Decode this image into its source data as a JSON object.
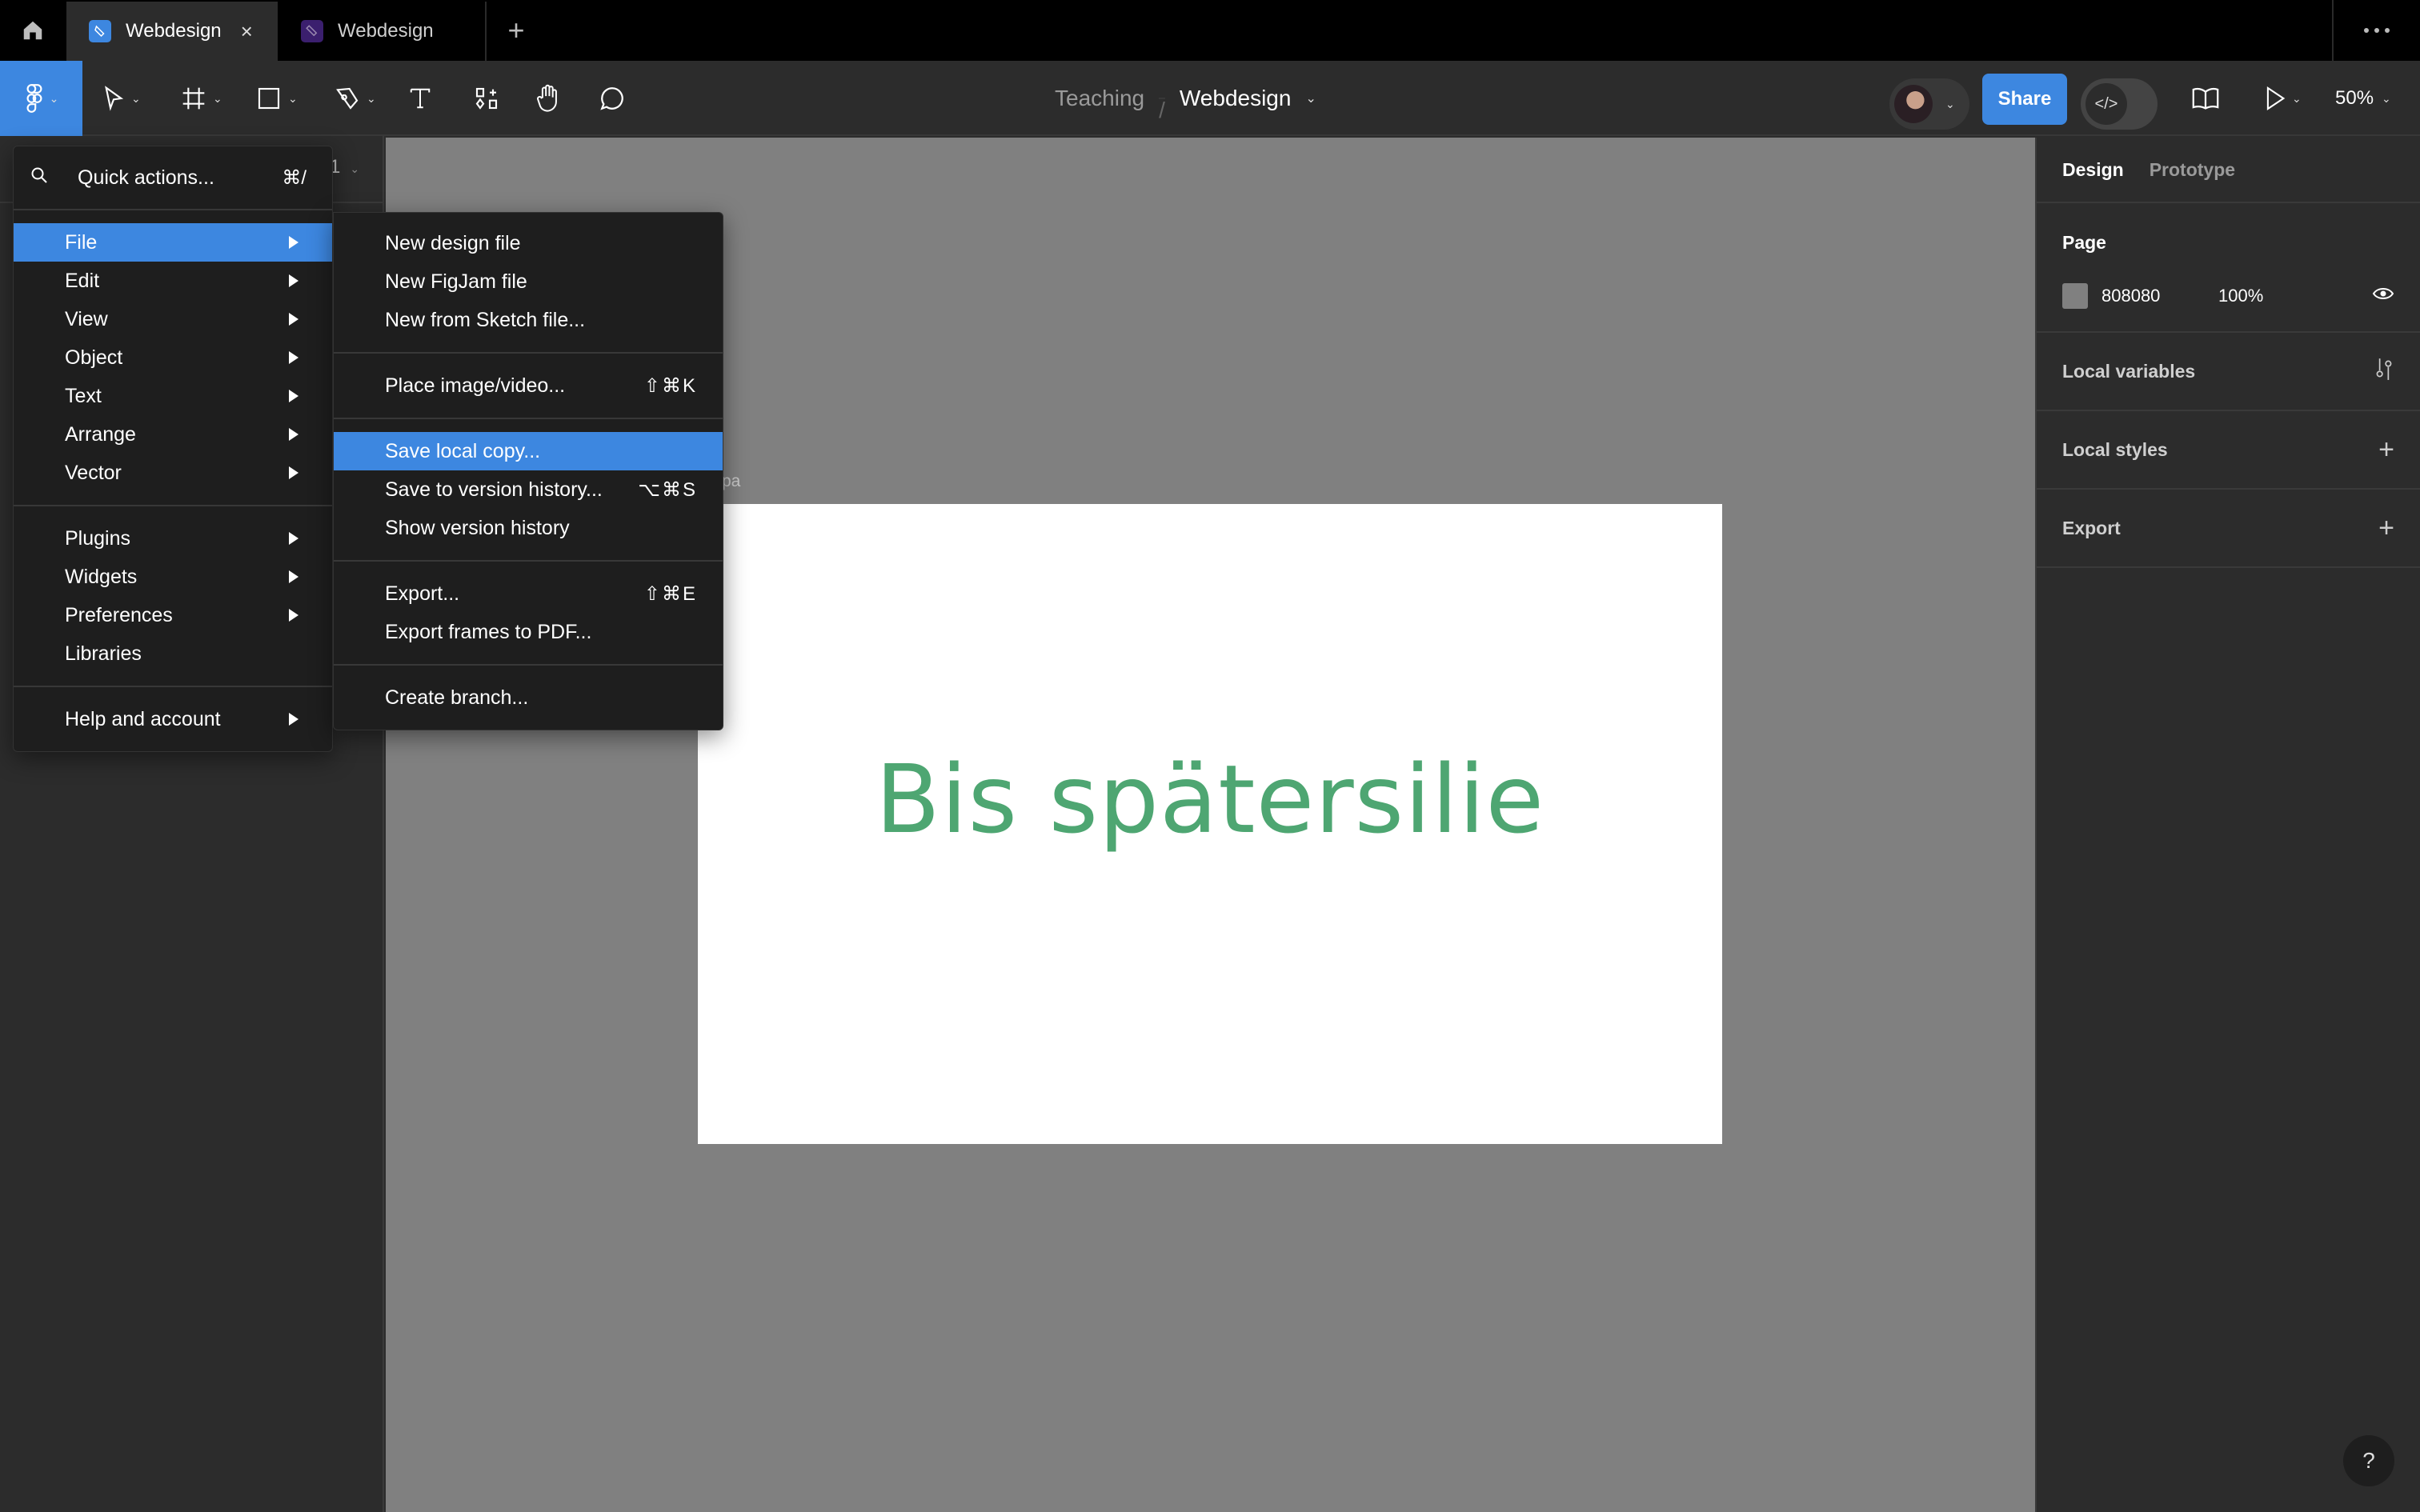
{
  "tabs": {
    "home_icon": "home-icon",
    "items": [
      {
        "label": "Webdesign",
        "icon": "figma-design-file-icon",
        "icon_color": "#3d87e0",
        "active": true,
        "close": "×"
      },
      {
        "label": "Webdesign",
        "icon": "figjam-file-icon",
        "icon_color": "#3b1f6e",
        "active": false
      }
    ],
    "new_tab": "+"
  },
  "toolbar": {
    "tools": [
      "move-tool",
      "frame-tool",
      "shape-tool",
      "pen-tool",
      "text-tool",
      "resources-tool",
      "hand-tool",
      "comment-tool"
    ],
    "breadcrumb": {
      "team": "Teaching",
      "separator": "/",
      "file": "Webdesign"
    },
    "share_label": "Share",
    "dev_mode_label": "</>",
    "zoom_label": "50%",
    "caret": "⌄"
  },
  "left_panel": {
    "pages_hint": "1"
  },
  "main_menu": {
    "quick_actions": {
      "label": "Quick actions...",
      "shortcut": "⌘/"
    },
    "groups": [
      [
        {
          "label": "File",
          "submenu": true,
          "highlighted": true
        },
        {
          "label": "Edit",
          "submenu": true
        },
        {
          "label": "View",
          "submenu": true
        },
        {
          "label": "Object",
          "submenu": true
        },
        {
          "label": "Text",
          "submenu": true
        },
        {
          "label": "Arrange",
          "submenu": true
        },
        {
          "label": "Vector",
          "submenu": true
        }
      ],
      [
        {
          "label": "Plugins",
          "submenu": true
        },
        {
          "label": "Widgets",
          "submenu": true
        },
        {
          "label": "Preferences",
          "submenu": true
        },
        {
          "label": "Libraries",
          "submenu": false
        }
      ],
      [
        {
          "label": "Help and account",
          "submenu": true
        }
      ]
    ]
  },
  "file_submenu": {
    "groups": [
      [
        {
          "label": "New design file",
          "shortcut": ""
        },
        {
          "label": "New FigJam file",
          "shortcut": ""
        },
        {
          "label": "New from Sketch file...",
          "shortcut": ""
        }
      ],
      [
        {
          "label": "Place image/video...",
          "shortcut": "⇧⌘K"
        }
      ],
      [
        {
          "label": "Save local copy...",
          "shortcut": "",
          "highlighted": true
        },
        {
          "label": "Save to version history...",
          "shortcut": "⌥⌘S"
        },
        {
          "label": "Show version history",
          "shortcut": ""
        }
      ],
      [
        {
          "label": "Export...",
          "shortcut": "⇧⌘E"
        },
        {
          "label": "Export frames to PDF...",
          "shortcut": ""
        }
      ],
      [
        {
          "label": "Create branch...",
          "shortcut": ""
        }
      ]
    ]
  },
  "canvas": {
    "background": "#808080",
    "frame_label": "pa",
    "frame_text": "Bis spätersilie",
    "frame_text_color": "#4ea672"
  },
  "right_panel": {
    "tabs": [
      {
        "label": "Design",
        "active": true
      },
      {
        "label": "Prototype",
        "active": false
      }
    ],
    "page": {
      "title": "Page",
      "color_hex": "808080",
      "opacity": "100%"
    },
    "sections": [
      {
        "label": "Local variables",
        "icon": "variables-icon"
      },
      {
        "label": "Local styles",
        "icon": "plus-icon"
      },
      {
        "label": "Export",
        "icon": "plus-icon"
      }
    ],
    "help_label": "?"
  },
  "colors": {
    "accent": "#3d87e0",
    "toolbar_bg": "#2c2c2c",
    "menu_bg": "#1e1e1e"
  }
}
